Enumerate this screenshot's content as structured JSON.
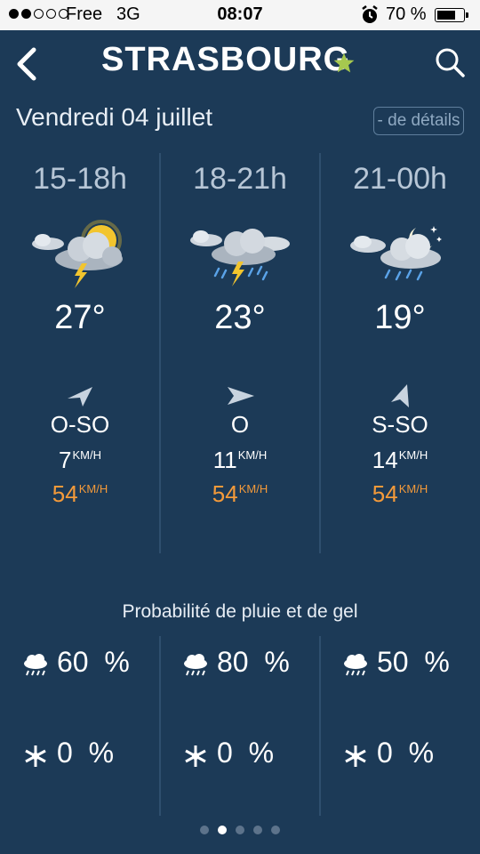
{
  "status_bar": {
    "carrier": "Free",
    "network": "3G",
    "time": "08:07",
    "battery_percent": "70 %",
    "signal_bars": 2,
    "battery_level": 0.7
  },
  "header": {
    "city": "STRASBOURG",
    "favorite": true
  },
  "date": "Vendredi 04 juillet",
  "details_button": "- de détails",
  "periods": [
    {
      "range": "15-18h",
      "icon": "storm-sun-icon",
      "temperature": "27°",
      "wind_dir": "O-SO",
      "wind_speed": "7",
      "wind_gust": "54",
      "rain": "60",
      "frost": "0"
    },
    {
      "range": "18-21h",
      "icon": "storm-rain-icon",
      "temperature": "23°",
      "wind_dir": "O",
      "wind_speed": "11",
      "wind_gust": "54",
      "rain": "80",
      "frost": "0"
    },
    {
      "range": "21-00h",
      "icon": "night-rain-icon",
      "temperature": "19°",
      "wind_dir": "S-SO",
      "wind_speed": "14",
      "wind_gust": "54",
      "rain": "50",
      "frost": "0"
    }
  ],
  "units": {
    "speed": "KM/H",
    "percent": "%"
  },
  "probability_title": "Probabilité de pluie et de gel",
  "pager": {
    "count": 5,
    "active_index": 1
  },
  "colors": {
    "background": "#1c3a57",
    "gust": "#f39a3a",
    "star": "#a6c84f"
  }
}
